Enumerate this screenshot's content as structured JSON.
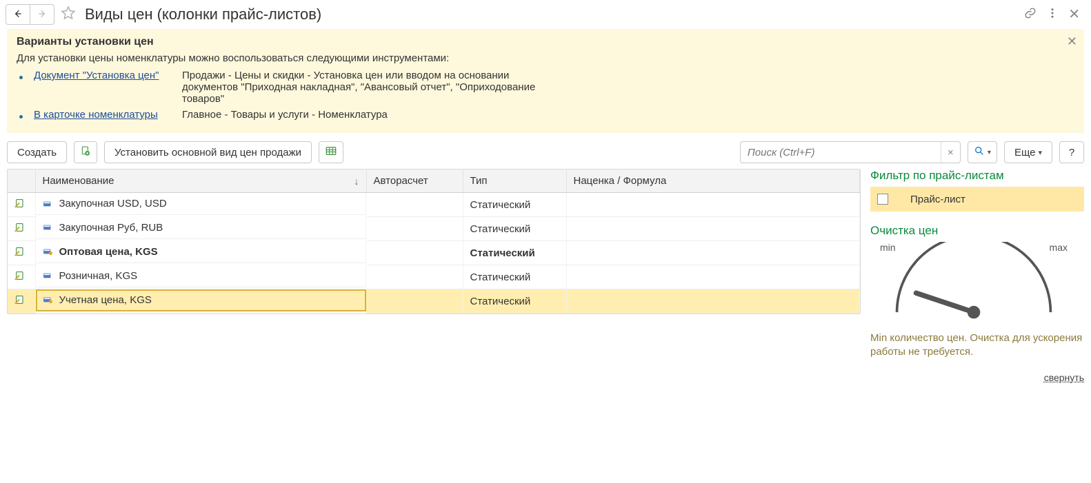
{
  "title": "Виды цен (колонки прайс-листов)",
  "banner": {
    "heading": "Варианты установки цен",
    "intro": "Для установки цены номенклатуры можно воспользоваться следующими инструментами:",
    "items": [
      {
        "link": "Документ \"Установка цен\"",
        "desc": "Продажи - Цены и скидки - Установка цен или вводом на основании документов \"Приходная накладная\", \"Авансовый отчет\", \"Оприходование товаров\""
      },
      {
        "link": "В карточке номенклатуры",
        "desc": "Главное - Товары и услуги - Номенклатура"
      }
    ]
  },
  "toolbar": {
    "create": "Создать",
    "set_main": "Установить основной вид цен продажи",
    "search_placeholder": "Поиск (Ctrl+F)",
    "more": "Еще",
    "help": "?"
  },
  "columns": {
    "name": "Наименование",
    "autocalc": "Авторасчет",
    "type": "Тип",
    "markup": "Наценка / Формула"
  },
  "rows": [
    {
      "name": "Закупочная USD, USD",
      "type": "Статический",
      "bold": false,
      "selected": false,
      "marked": false
    },
    {
      "name": "Закупочная Руб, RUB",
      "type": "Статический",
      "bold": false,
      "selected": false,
      "marked": false
    },
    {
      "name": "Оптовая цена, KGS",
      "type": "Статический",
      "bold": true,
      "selected": false,
      "marked": true
    },
    {
      "name": "Розничная, KGS",
      "type": "Статический",
      "bold": false,
      "selected": false,
      "marked": false
    },
    {
      "name": "Учетная цена, KGS",
      "type": "Статический",
      "bold": false,
      "selected": true,
      "marked": true
    }
  ],
  "side": {
    "filter_title": "Фильтр по прайс-листам",
    "filter_item": "Прайс-лист",
    "cleanup_title": "Очистка цен",
    "gauge_min": "min",
    "gauge_max": "max",
    "note": "Min количество цен. Очистка для ускорения работы не требуется.",
    "collapse": "свернуть"
  }
}
